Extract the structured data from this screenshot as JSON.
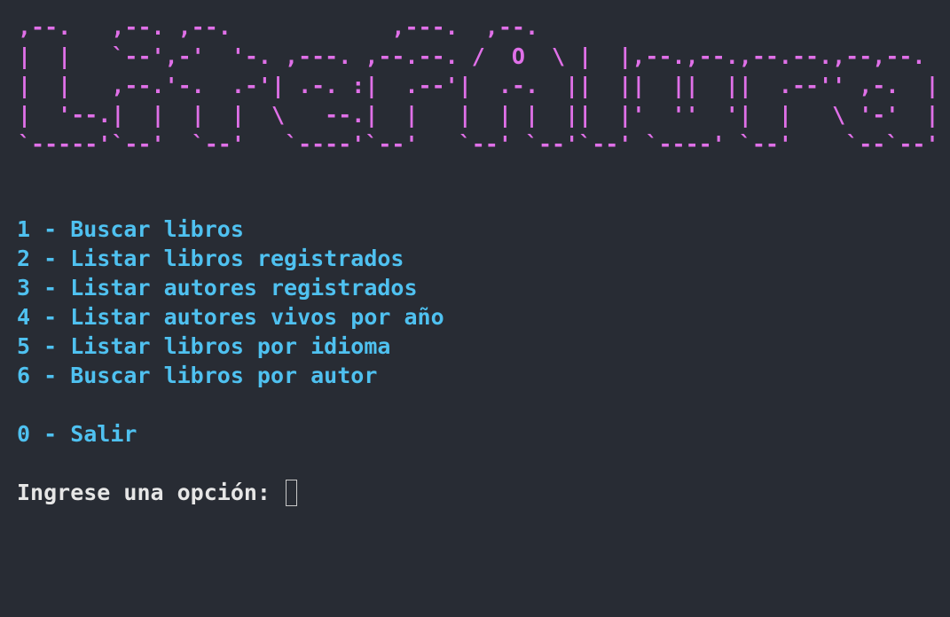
{
  "colors": {
    "background": "#282c34",
    "banner": "#e070e8",
    "menu": "#4fc1f0",
    "prompt": "#e6e6e6"
  },
  "banner": {
    "art": ",--.   ,--. ,--.            ,---.  ,--.\n|  |   `--',-'  '-. ,---. ,--.--. /  O  \\ |  |,--.,--.,--.--.,--,--.\n|  |   ,--.'-.  .-'| .-. :|  .--'|  .-.  ||  ||  ||  ||  .--'' ,-.  |\n|  '--.|  |  |  |  \\   --.|  |   |  | |  ||  |'  ''  '|  |   \\ '-'  |\n`-----'`--'  `--'   `----'`--'   `--' `--'`--' `----' `--'    `--`--'"
  },
  "menu": {
    "items": [
      "1 - Buscar libros",
      "2 - Listar libros registrados",
      "3 - Listar autores registrados",
      "4 - Listar autores vivos por año",
      "5 - Listar libros por idioma",
      "6 - Buscar libros por autor"
    ],
    "exit": "0 - Salir"
  },
  "prompt": {
    "label": "Ingrese una opción: ",
    "value": ""
  }
}
